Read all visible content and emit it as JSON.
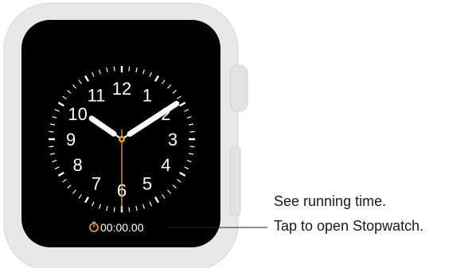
{
  "watch": {
    "case_color": "#e8e8e8",
    "case_edge_color": "#d6d6d6",
    "screen_color": "#000000",
    "accent_color": "#f5a623",
    "hand_color": "#ffffff",
    "numerals": [
      "12",
      "1",
      "2",
      "3",
      "4",
      "5",
      "6",
      "7",
      "8",
      "9",
      "10",
      "11"
    ],
    "time": {
      "hour": 10,
      "minute": 9,
      "second": 30
    }
  },
  "complication": {
    "icon": "stopwatch-icon",
    "value": "00:00.00"
  },
  "callout": {
    "line1": "See running time.",
    "line2": "Tap to open Stopwatch."
  }
}
